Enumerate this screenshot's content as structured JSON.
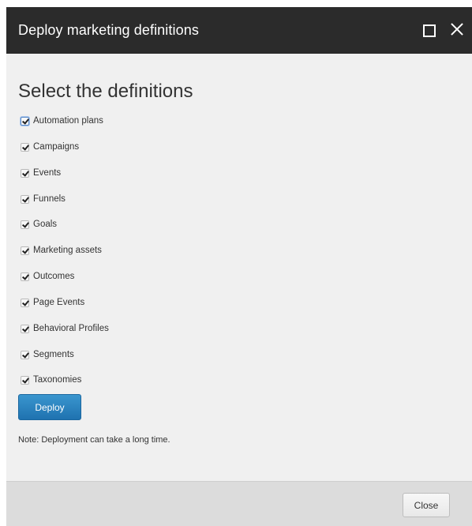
{
  "dialog": {
    "title": "Deploy marketing definitions",
    "maximize_icon": "maximize-icon",
    "close_icon": "close-icon"
  },
  "main": {
    "heading": "Select the definitions",
    "definitions": [
      {
        "label": "Automation plans",
        "checked": true
      },
      {
        "label": "Campaigns",
        "checked": true
      },
      {
        "label": "Events",
        "checked": true
      },
      {
        "label": "Funnels",
        "checked": true
      },
      {
        "label": "Goals",
        "checked": true
      },
      {
        "label": "Marketing assets",
        "checked": true
      },
      {
        "label": "Outcomes",
        "checked": true
      },
      {
        "label": "Page Events",
        "checked": true
      },
      {
        "label": "Behavioral Profiles",
        "checked": true
      },
      {
        "label": "Segments",
        "checked": true
      },
      {
        "label": "Taxonomies",
        "checked": true
      }
    ],
    "deploy_label": "Deploy",
    "note": "Note: Deployment can take a long time."
  },
  "footer": {
    "close_label": "Close"
  },
  "colors": {
    "titlebar": "#2b2b2b",
    "accent": "#2a84c2",
    "background": "#f0f0f0",
    "footer": "#dcdcdc"
  }
}
